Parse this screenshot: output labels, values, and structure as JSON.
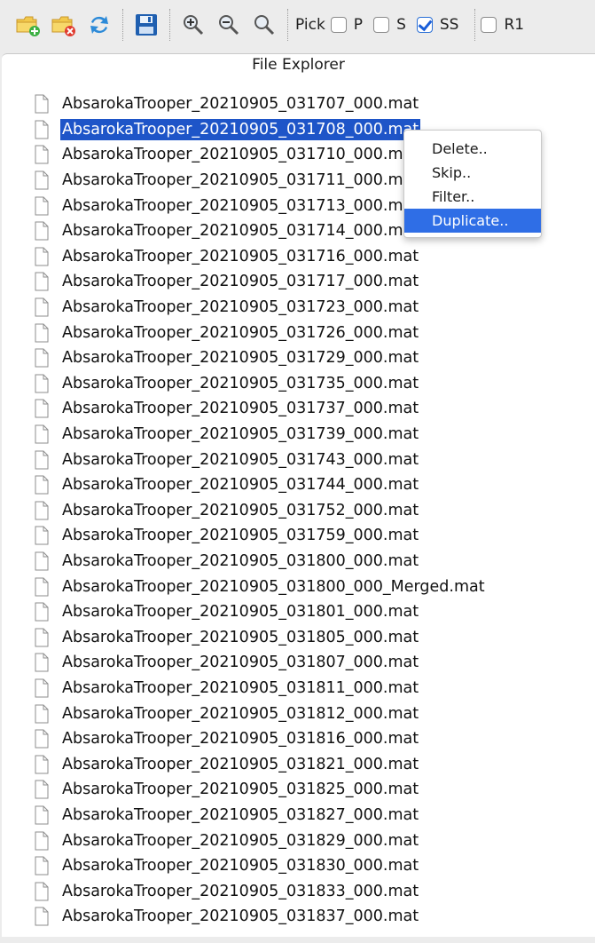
{
  "toolbar": {
    "buttons": [
      {
        "icon": "open-folder-add-icon"
      },
      {
        "icon": "close-folder-remove-icon"
      },
      {
        "icon": "refresh-icon"
      },
      {
        "icon": "save-icon"
      },
      {
        "icon": "zoom-in-icon"
      },
      {
        "icon": "zoom-out-icon"
      },
      {
        "icon": "zoom-reset-icon"
      }
    ],
    "pick_label": "Pick",
    "checkboxes": [
      {
        "label": "P",
        "checked": false
      },
      {
        "label": "S",
        "checked": false
      },
      {
        "label": "SS",
        "checked": true
      },
      {
        "label": "R1",
        "checked": false
      }
    ]
  },
  "panel": {
    "title": "File Explorer"
  },
  "files": [
    {
      "name": "AbsarokaTrooper_20210905_031707_000.mat",
      "selected": false
    },
    {
      "name": "AbsarokaTrooper_20210905_031708_000.mat",
      "selected": true
    },
    {
      "name": "AbsarokaTrooper_20210905_031710_000.mat",
      "selected": false
    },
    {
      "name": "AbsarokaTrooper_20210905_031711_000.mat",
      "selected": false
    },
    {
      "name": "AbsarokaTrooper_20210905_031713_000.mat",
      "selected": false
    },
    {
      "name": "AbsarokaTrooper_20210905_031714_000.mat",
      "selected": false
    },
    {
      "name": "AbsarokaTrooper_20210905_031716_000.mat",
      "selected": false
    },
    {
      "name": "AbsarokaTrooper_20210905_031717_000.mat",
      "selected": false
    },
    {
      "name": "AbsarokaTrooper_20210905_031723_000.mat",
      "selected": false
    },
    {
      "name": "AbsarokaTrooper_20210905_031726_000.mat",
      "selected": false
    },
    {
      "name": "AbsarokaTrooper_20210905_031729_000.mat",
      "selected": false
    },
    {
      "name": "AbsarokaTrooper_20210905_031735_000.mat",
      "selected": false
    },
    {
      "name": "AbsarokaTrooper_20210905_031737_000.mat",
      "selected": false
    },
    {
      "name": "AbsarokaTrooper_20210905_031739_000.mat",
      "selected": false
    },
    {
      "name": "AbsarokaTrooper_20210905_031743_000.mat",
      "selected": false
    },
    {
      "name": "AbsarokaTrooper_20210905_031744_000.mat",
      "selected": false
    },
    {
      "name": "AbsarokaTrooper_20210905_031752_000.mat",
      "selected": false
    },
    {
      "name": "AbsarokaTrooper_20210905_031759_000.mat",
      "selected": false
    },
    {
      "name": "AbsarokaTrooper_20210905_031800_000.mat",
      "selected": false
    },
    {
      "name": "AbsarokaTrooper_20210905_031800_000_Merged.mat",
      "selected": false
    },
    {
      "name": "AbsarokaTrooper_20210905_031801_000.mat",
      "selected": false
    },
    {
      "name": "AbsarokaTrooper_20210905_031805_000.mat",
      "selected": false
    },
    {
      "name": "AbsarokaTrooper_20210905_031807_000.mat",
      "selected": false
    },
    {
      "name": "AbsarokaTrooper_20210905_031811_000.mat",
      "selected": false
    },
    {
      "name": "AbsarokaTrooper_20210905_031812_000.mat",
      "selected": false
    },
    {
      "name": "AbsarokaTrooper_20210905_031816_000.mat",
      "selected": false
    },
    {
      "name": "AbsarokaTrooper_20210905_031821_000.mat",
      "selected": false
    },
    {
      "name": "AbsarokaTrooper_20210905_031825_000.mat",
      "selected": false
    },
    {
      "name": "AbsarokaTrooper_20210905_031827_000.mat",
      "selected": false
    },
    {
      "name": "AbsarokaTrooper_20210905_031829_000.mat",
      "selected": false
    },
    {
      "name": "AbsarokaTrooper_20210905_031830_000.mat",
      "selected": false
    },
    {
      "name": "AbsarokaTrooper_20210905_031833_000.mat",
      "selected": false
    },
    {
      "name": "AbsarokaTrooper_20210905_031837_000.mat",
      "selected": false
    }
  ],
  "context_menu": {
    "items": [
      {
        "label": "Delete..",
        "active": false
      },
      {
        "label": "Skip..",
        "active": false
      },
      {
        "label": "Filter..",
        "active": false
      },
      {
        "label": "Duplicate..",
        "active": true
      }
    ]
  },
  "colors": {
    "selection": "#1e55c8",
    "menu_highlight": "#2f6ee6",
    "checkbox_check": "#1a5ed8"
  }
}
